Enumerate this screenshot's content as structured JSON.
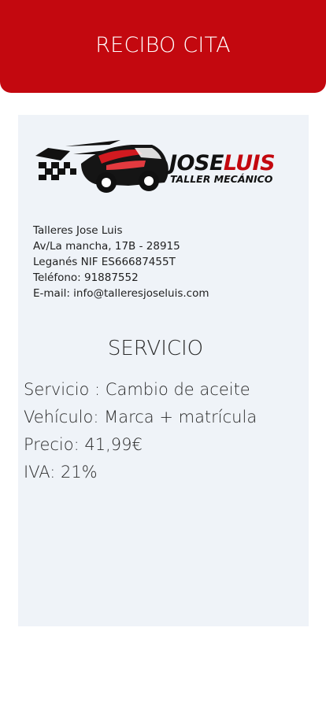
{
  "header": {
    "title": "RECIBO CITA"
  },
  "logo": {
    "name_part1": "JOSE",
    "name_part2": "LUIS",
    "subtitle": "TALLER MECÁNICO"
  },
  "company": {
    "lines": [
      "Talleres Jose Luis",
      "Av/La mancha, 17B - 28915",
      "Leganés NIF ES66687455T",
      "Teléfono: 91887552",
      "E-mail: info@talleresjoseluis.com"
    ]
  },
  "service": {
    "title": "SERVICIO",
    "lines": [
      "Servicio : Cambio de aceite",
      "Vehículo: Marca + matrícula",
      "Precio: 41,99€",
      "IVA: 21%"
    ]
  },
  "colors": {
    "brand_red": "#c3080f",
    "card_background": "#eff3f8"
  }
}
